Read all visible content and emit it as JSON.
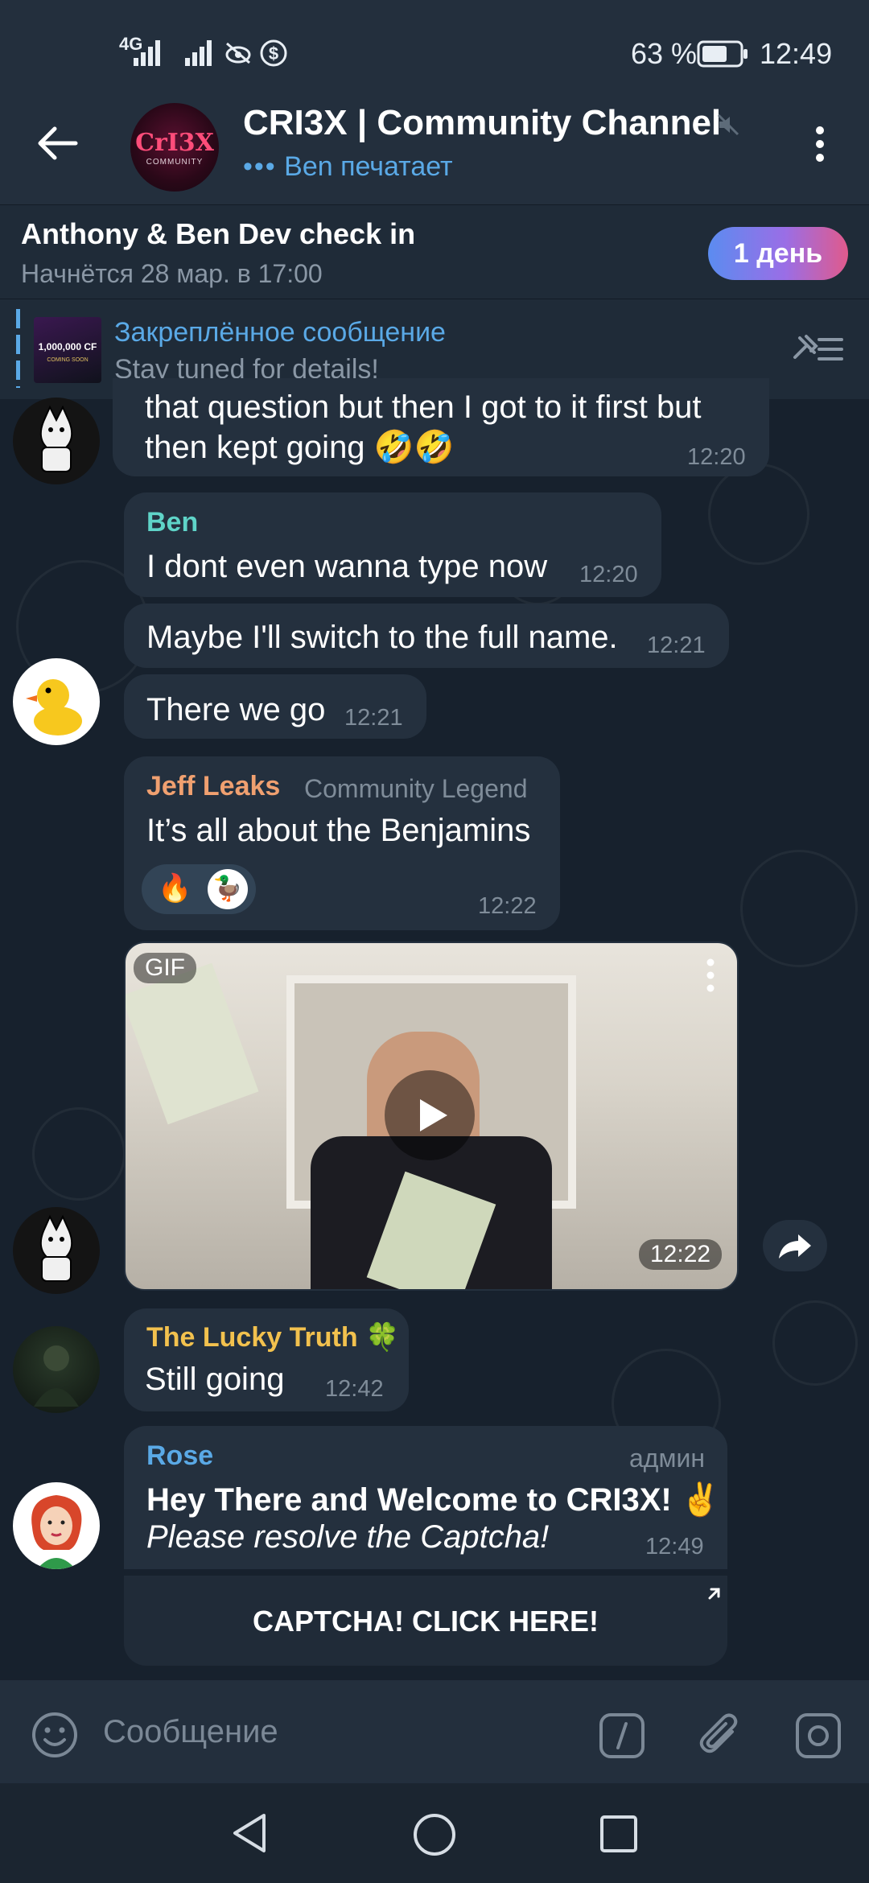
{
  "status_bar": {
    "network": "4G",
    "battery": "63 %",
    "time": "12:49"
  },
  "header": {
    "title": "CRI3X | Community Channel",
    "typing": "Ben печатает",
    "avatar_text": "CrI3X",
    "avatar_sub": "COMMUNITY"
  },
  "event": {
    "title": "Anthony & Ben Dev check in",
    "subtitle": "Начнётся 28 мар. в 17:00",
    "badge": "1 день"
  },
  "pinned": {
    "title": "Закреплённое сообщение",
    "text": "Stay tuned for details!",
    "thumb_text": "1,000,000 CF",
    "thumb_sub": "COMING SOON"
  },
  "messages": {
    "m1": {
      "line1": "that question but then I got to it first but",
      "line2": "then kept going 🤣🤣",
      "time": "12:20"
    },
    "m2": {
      "sender": "Ben",
      "text": "I dont even wanna type now",
      "time": "12:20"
    },
    "m3": {
      "text": "Maybe I'll switch to the full name.",
      "time": "12:21"
    },
    "m4": {
      "text": "There we go",
      "time": "12:21"
    },
    "m5": {
      "sender": "Jeff Leaks",
      "badge": "Community Legend",
      "text": "It’s all about the Benjamins",
      "reactions": [
        "🔥",
        "🦆"
      ],
      "time": "12:22"
    },
    "gif": {
      "label": "GIF",
      "time": "12:22"
    },
    "m6": {
      "sender": "The Lucky Truth 🍀",
      "text": "Still going",
      "time": "12:42"
    },
    "m7": {
      "sender": "Rose",
      "role": "админ",
      "line1": "Hey There and Welcome to CRI3X! ✌️",
      "line2": "Please resolve the Captcha!",
      "time": "12:49",
      "button": "CAPTCHA! CLICK HERE!"
    }
  },
  "input": {
    "placeholder": "Сообщение"
  },
  "colors": {
    "accent": "#5aa9e6",
    "sender_ben": "#5fd4c8",
    "sender_jeff": "#f0a070",
    "sender_lucky": "#f2c14e",
    "sender_rose": "#5aa9e6"
  }
}
